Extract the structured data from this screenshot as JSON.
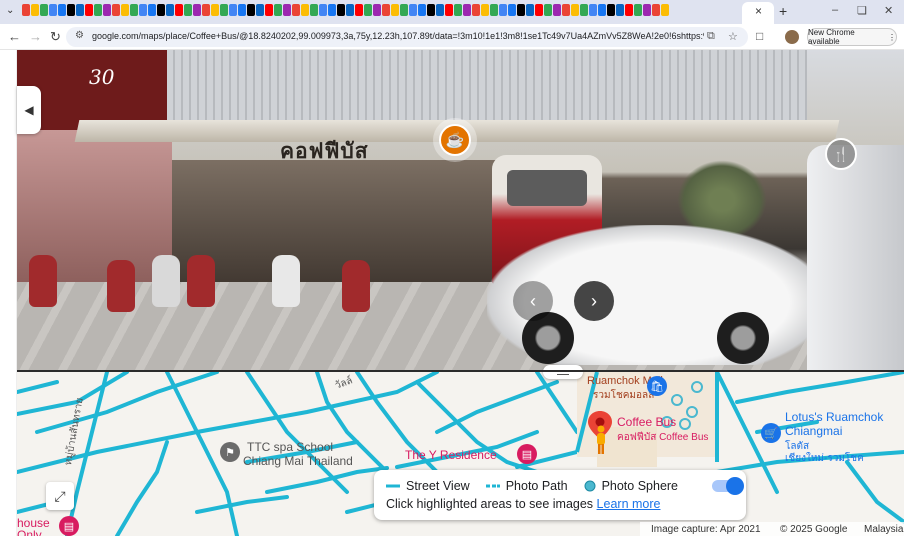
{
  "browser": {
    "url": "google.com/maps/place/Coffee+Bus/@18.8240202,99.009973,3a,75y,12.23h,107.89t/data=!3m10!1e1!3m8!1se1Tc49v7Ua4AZmVv5Z8WeA!2e0!6shttps:%2F%2Fstreetv...",
    "new_chrome_label": "New Chrome available",
    "tab_close": "×",
    "new_tab": "+",
    "minimize": "–",
    "maximize": "❏",
    "close": "✕"
  },
  "street_view": {
    "shop_sign_text": "คอฟฟีบัส",
    "left_sign_number": "30",
    "collapse_icon": "chevron-left-icon",
    "cafe_icon": "coffee-cup-icon",
    "restaurant_icon": "fork-knife-icon"
  },
  "map": {
    "labels": {
      "ruamchok_mall": "Ruamchok Mall",
      "ruamchok_mall_thai": "รวมโชคมอลล์",
      "coffee_bus": "Coffee Bus",
      "coffee_bus_thai": "คอฟฟีบัส Coffee Bus",
      "ttc_1": "TTC spa School",
      "ttc_2": "Chiang Mai Thailand",
      "y_residence": "The Y Residence",
      "lotus_1": "Lotus's Ruamchok",
      "lotus_2": "Chiangmai",
      "lotus_thai_1": "โลตัส",
      "lotus_thai_2": "เชียงใหม่-รวมโชค",
      "house_1": "house",
      "house_2": "Only",
      "road_thai": "หมู่บ้านสันทราย",
      "road_thai_2": "วัลล์"
    },
    "road_color": "#1fb6d4",
    "accent_pink": "#d81b60",
    "accent_blue": "#1a73e8"
  },
  "legend": {
    "street_view": "Street View",
    "photo_path": "Photo Path",
    "photo_sphere": "Photo Sphere",
    "hint": "Click highlighted areas to see images",
    "learn_more": "Learn more"
  },
  "footer": {
    "capture": "Image capture: Apr 2021",
    "copyright": "© 2025 Google",
    "region": "Malaysia"
  }
}
